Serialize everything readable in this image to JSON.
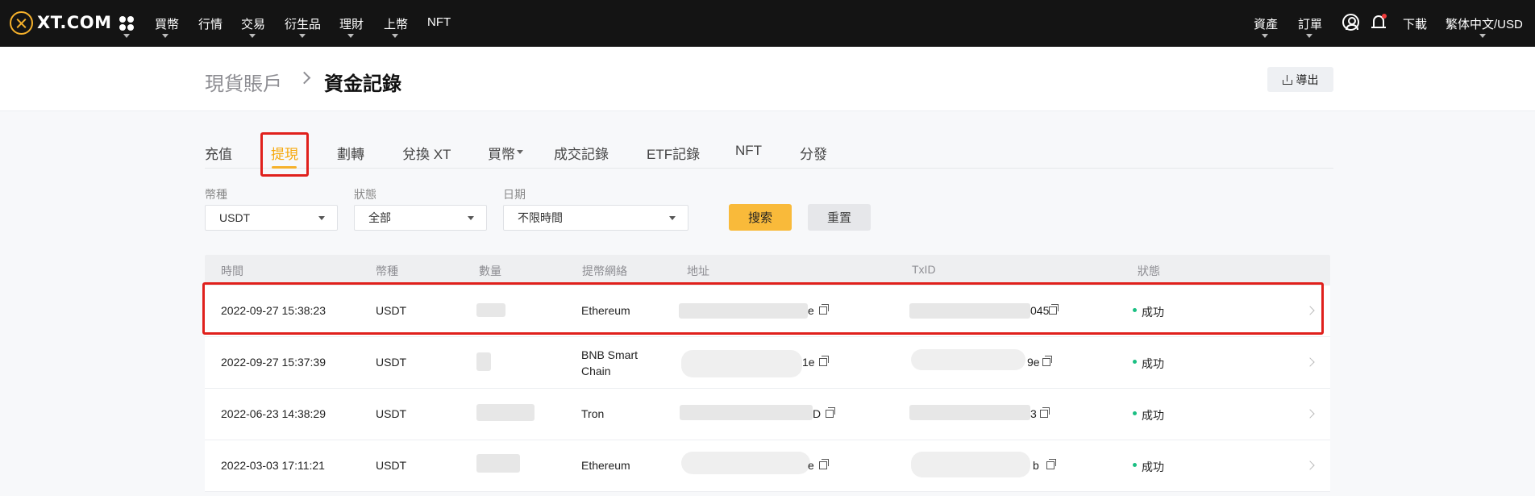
{
  "nav": {
    "logo_text": "XT.COM",
    "items": [
      {
        "label": "買幣",
        "caret": true
      },
      {
        "label": "行情",
        "caret": false
      },
      {
        "label": "交易",
        "caret": true
      },
      {
        "label": "衍生品",
        "caret": true
      },
      {
        "label": "理財",
        "caret": true
      },
      {
        "label": "上幣",
        "caret": true
      },
      {
        "label": "NFT",
        "caret": false
      }
    ],
    "right": {
      "assets": "資產",
      "orders": "訂單",
      "download": "下載",
      "lang_currency": "繁体中文/USD"
    }
  },
  "breadcrumb": {
    "parent": "現貨賬戶",
    "current": "資金記錄"
  },
  "export_label": "導出",
  "tabs": [
    "充值",
    "提現",
    "劃轉",
    "兌換 XT",
    "買幣",
    "成交記錄",
    "ETF記錄",
    "NFT",
    "分發"
  ],
  "active_tab": "提現",
  "filters": {
    "currency": {
      "label": "幣種",
      "value": "USDT"
    },
    "status": {
      "label": "狀態",
      "value": "全部"
    },
    "date": {
      "label": "日期",
      "value": "不限時間"
    },
    "search_label": "搜索",
    "reset_label": "重置"
  },
  "table": {
    "columns": [
      "時間",
      "幣種",
      "數量",
      "提幣網絡",
      "地址",
      "TxID",
      "狀態"
    ],
    "rows": [
      {
        "time": "2022-09-27 15:38:23",
        "currency": "USDT",
        "network": "Ethereum",
        "address_tail": "e",
        "txid_tail": "045",
        "status": "成功"
      },
      {
        "time": "2022-09-27 15:37:39",
        "currency": "USDT",
        "network": "BNB Smart Chain",
        "address_tail": "1e",
        "txid_tail": "9e",
        "status": "成功"
      },
      {
        "time": "2022-06-23 14:38:29",
        "currency": "USDT",
        "network": "Tron",
        "address_tail": "D",
        "txid_tail": "3",
        "status": "成功"
      },
      {
        "time": "2022-03-03 17:11:21",
        "currency": "USDT",
        "network": "Ethereum",
        "address_tail": "e",
        "txid_tail": "b",
        "status": "成功"
      }
    ]
  },
  "colors": {
    "accent": "#f6b12b",
    "highlight": "#e0201c",
    "success": "#1bbf83"
  }
}
